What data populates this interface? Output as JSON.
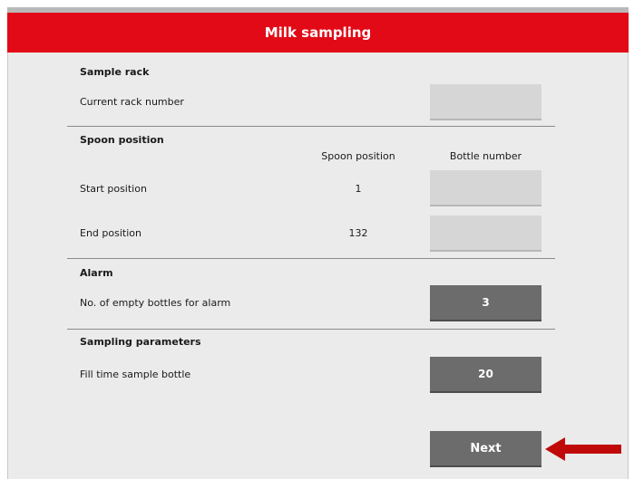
{
  "header": {
    "title": "Milk sampling"
  },
  "sample_rack": {
    "section_title": "Sample rack",
    "current_rack_label": "Current rack number",
    "current_rack_value": ""
  },
  "spoon_position": {
    "section_title": "Spoon position",
    "col_spoon": "Spoon position",
    "col_bottle": "Bottle number",
    "start_label": "Start position",
    "start_spoon": "1",
    "start_bottle": "",
    "end_label": "End position",
    "end_spoon": "132",
    "end_bottle": ""
  },
  "alarm": {
    "section_title": "Alarm",
    "empty_bottles_label": "No. of empty bottles for alarm",
    "empty_bottles_value": "3"
  },
  "sampling_parameters": {
    "section_title": "Sampling parameters",
    "fill_time_label": "Fill time sample bottle",
    "fill_time_value": "20"
  },
  "footer": {
    "next_label": "Next"
  },
  "colors": {
    "title_bar": "#e20a17",
    "panel_bg": "#ebebeb",
    "field_empty": "#d6d6d6",
    "field_filled": "#6c6c6c",
    "arrow": "#c00a0a"
  }
}
